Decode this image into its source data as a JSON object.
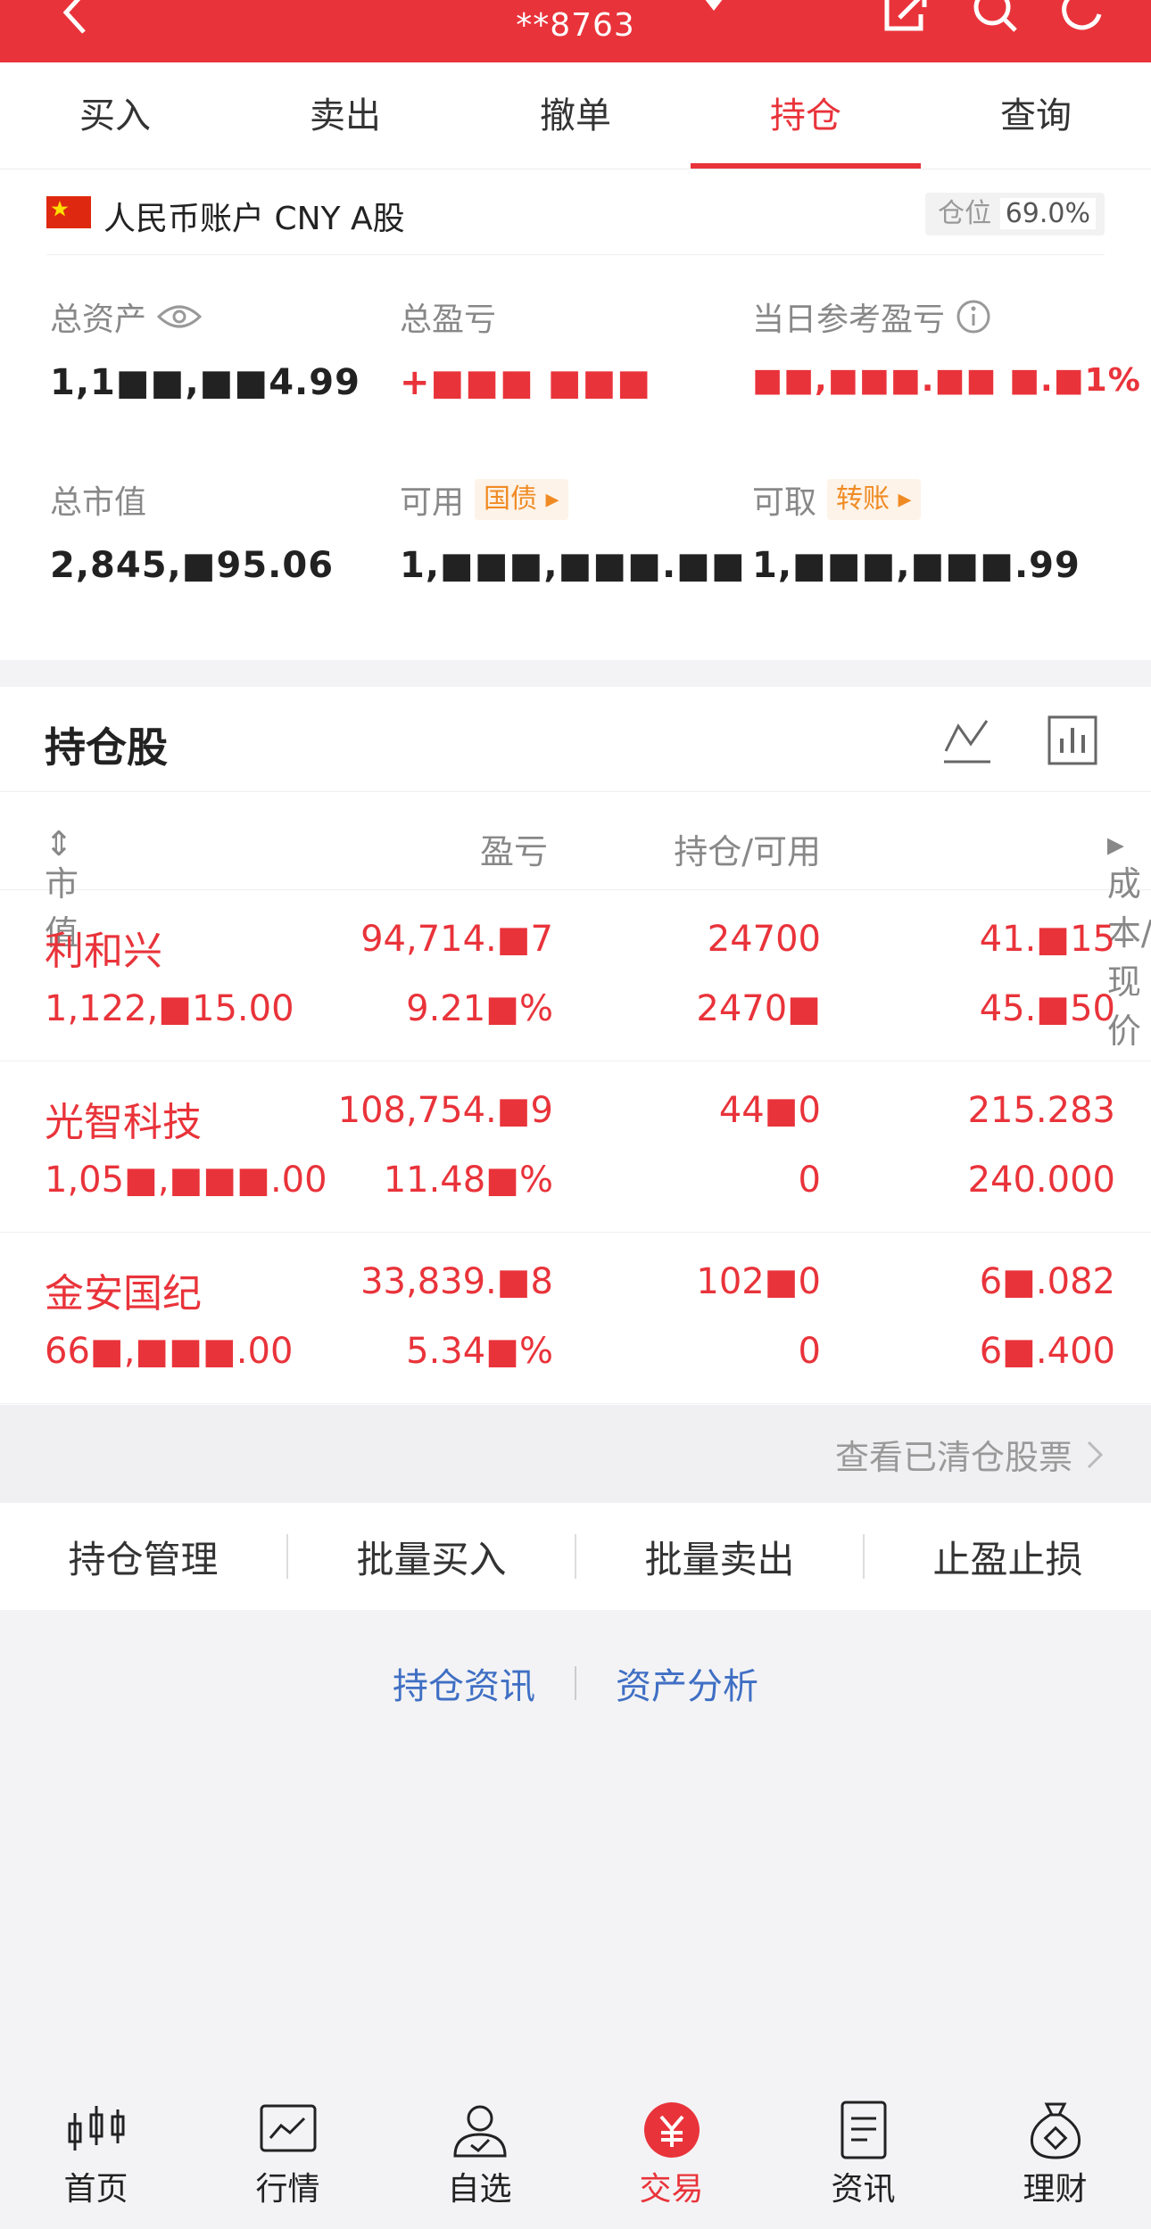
{
  "header": {
    "account_masked": "**8763"
  },
  "tabs": [
    {
      "label": "买入",
      "active": false
    },
    {
      "label": "卖出",
      "active": false
    },
    {
      "label": "撤单",
      "active": false
    },
    {
      "label": "持仓",
      "active": true
    },
    {
      "label": "查询",
      "active": false
    }
  ],
  "account": {
    "type_label": "人民币账户 CNY A股",
    "position_label": "仓位",
    "position_value": "69.0%",
    "total_assets_label": "总资产",
    "total_assets_value": "1,1■■,■■4.99",
    "total_pl_label": "总盈亏",
    "total_pl_value": "+■■■ ■■■",
    "daily_pl_label": "当日参考盈亏",
    "daily_pl_value": "■■,■■■.■■ ■.■1%",
    "market_value_label": "总市值",
    "market_value_value": "2,845,■95.06",
    "available_label": "可用",
    "available_tag": "国债",
    "available_value": "1,■■■,■■■.■■",
    "withdrawable_label": "可取",
    "withdrawable_tag": "转账",
    "withdrawable_value": "1,■■■,■■■.99"
  },
  "holdings": {
    "title": "持仓股",
    "col_market_value": "市值",
    "col_pl": "盈亏",
    "col_position": "持仓/可用",
    "col_cost": "成本/现价",
    "rows": [
      {
        "name": "利和兴",
        "market_value": "1,122,■15.00",
        "pl": "94,714.■7",
        "pl_pct": "9.21■%",
        "position": "24700",
        "available": "2470■",
        "cost": "41.■15",
        "price": "45.■50"
      },
      {
        "name": "光智科技",
        "market_value": "1,05■,■■■.00",
        "pl": "108,754.■9",
        "pl_pct": "11.48■%",
        "position": "44■0",
        "available": "0",
        "cost": "215.283",
        "price": "240.000"
      },
      {
        "name": "金安国纪",
        "market_value": "66■,■■■.00",
        "pl": "33,839.■8",
        "pl_pct": "5.34■%",
        "position": "102■0",
        "available": "0",
        "cost": "6■.082",
        "price": "6■.400"
      }
    ]
  },
  "cleared_link": "查看已清仓股票",
  "actions": [
    "持仓管理",
    "批量买入",
    "批量卖出",
    "止盈止损"
  ],
  "links": [
    "持仓资讯",
    "资产分析"
  ],
  "bottom_nav": [
    {
      "label": "首页",
      "icon": "candlestick-icon"
    },
    {
      "label": "行情",
      "icon": "chart-monitor-icon"
    },
    {
      "label": "自选",
      "icon": "user-check-icon"
    },
    {
      "label": "交易",
      "icon": "yen-coin-icon",
      "active": true
    },
    {
      "label": "资讯",
      "icon": "document-icon"
    },
    {
      "label": "理财",
      "icon": "money-bag-icon"
    }
  ],
  "colors": {
    "accent": "#e9333a",
    "link": "#3f6fc4",
    "tag": "#f08b24"
  }
}
